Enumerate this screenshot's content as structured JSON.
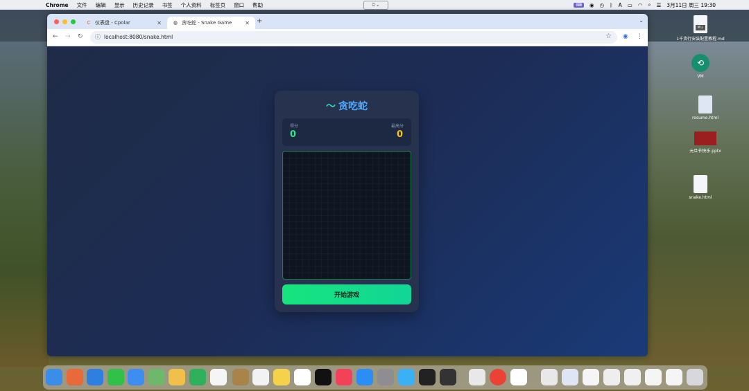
{
  "menubar": {
    "app": "Chrome",
    "items": [
      "文件",
      "编辑",
      "显示",
      "历史记录",
      "书签",
      "个人资料",
      "标签页",
      "窗口",
      "帮助"
    ],
    "datetime": "3月11日 周三  19:30",
    "input_indicator": "A"
  },
  "browser": {
    "tabs": [
      {
        "label": "仪表盘 - Cpolar",
        "icon": "cpolar-icon"
      },
      {
        "label": "贪吃蛇 - Snake Game",
        "icon": "globe-icon"
      }
    ],
    "url": "localhost:8080/snake.html"
  },
  "game": {
    "title": "贪吃蛇",
    "score_label": "得分",
    "score_value": "0",
    "high_score_label": "最高分",
    "high_score_value": "0",
    "start_button": "开始游戏",
    "colors": {
      "title": "#4fa9ff",
      "score": "#2ee58a",
      "high_score": "#f5c518",
      "button": "#17e47e"
    }
  },
  "desktop": {
    "icons": [
      {
        "label": "1千货行安装配置教程.md"
      },
      {
        "label": "VM"
      },
      {
        "label": "resume.html"
      },
      {
        "label": "元旦节快乐.pptx"
      },
      {
        "label": "snake.html"
      }
    ]
  }
}
